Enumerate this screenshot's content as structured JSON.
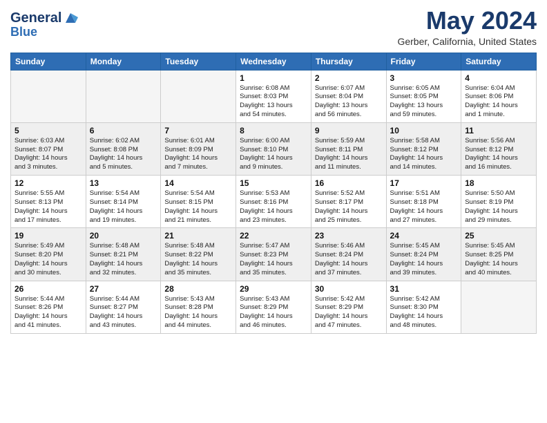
{
  "header": {
    "logo_line1": "General",
    "logo_line2": "Blue",
    "title": "May 2024",
    "subtitle": "Gerber, California, United States"
  },
  "weekdays": [
    "Sunday",
    "Monday",
    "Tuesday",
    "Wednesday",
    "Thursday",
    "Friday",
    "Saturday"
  ],
  "weeks": [
    [
      {
        "day": "",
        "info": ""
      },
      {
        "day": "",
        "info": ""
      },
      {
        "day": "",
        "info": ""
      },
      {
        "day": "1",
        "info": "Sunrise: 6:08 AM\nSunset: 8:03 PM\nDaylight: 13 hours\nand 54 minutes."
      },
      {
        "day": "2",
        "info": "Sunrise: 6:07 AM\nSunset: 8:04 PM\nDaylight: 13 hours\nand 56 minutes."
      },
      {
        "day": "3",
        "info": "Sunrise: 6:05 AM\nSunset: 8:05 PM\nDaylight: 13 hours\nand 59 minutes."
      },
      {
        "day": "4",
        "info": "Sunrise: 6:04 AM\nSunset: 8:06 PM\nDaylight: 14 hours\nand 1 minute."
      }
    ],
    [
      {
        "day": "5",
        "info": "Sunrise: 6:03 AM\nSunset: 8:07 PM\nDaylight: 14 hours\nand 3 minutes."
      },
      {
        "day": "6",
        "info": "Sunrise: 6:02 AM\nSunset: 8:08 PM\nDaylight: 14 hours\nand 5 minutes."
      },
      {
        "day": "7",
        "info": "Sunrise: 6:01 AM\nSunset: 8:09 PM\nDaylight: 14 hours\nand 7 minutes."
      },
      {
        "day": "8",
        "info": "Sunrise: 6:00 AM\nSunset: 8:10 PM\nDaylight: 14 hours\nand 9 minutes."
      },
      {
        "day": "9",
        "info": "Sunrise: 5:59 AM\nSunset: 8:11 PM\nDaylight: 14 hours\nand 11 minutes."
      },
      {
        "day": "10",
        "info": "Sunrise: 5:58 AM\nSunset: 8:12 PM\nDaylight: 14 hours\nand 14 minutes."
      },
      {
        "day": "11",
        "info": "Sunrise: 5:56 AM\nSunset: 8:12 PM\nDaylight: 14 hours\nand 16 minutes."
      }
    ],
    [
      {
        "day": "12",
        "info": "Sunrise: 5:55 AM\nSunset: 8:13 PM\nDaylight: 14 hours\nand 17 minutes."
      },
      {
        "day": "13",
        "info": "Sunrise: 5:54 AM\nSunset: 8:14 PM\nDaylight: 14 hours\nand 19 minutes."
      },
      {
        "day": "14",
        "info": "Sunrise: 5:54 AM\nSunset: 8:15 PM\nDaylight: 14 hours\nand 21 minutes."
      },
      {
        "day": "15",
        "info": "Sunrise: 5:53 AM\nSunset: 8:16 PM\nDaylight: 14 hours\nand 23 minutes."
      },
      {
        "day": "16",
        "info": "Sunrise: 5:52 AM\nSunset: 8:17 PM\nDaylight: 14 hours\nand 25 minutes."
      },
      {
        "day": "17",
        "info": "Sunrise: 5:51 AM\nSunset: 8:18 PM\nDaylight: 14 hours\nand 27 minutes."
      },
      {
        "day": "18",
        "info": "Sunrise: 5:50 AM\nSunset: 8:19 PM\nDaylight: 14 hours\nand 29 minutes."
      }
    ],
    [
      {
        "day": "19",
        "info": "Sunrise: 5:49 AM\nSunset: 8:20 PM\nDaylight: 14 hours\nand 30 minutes."
      },
      {
        "day": "20",
        "info": "Sunrise: 5:48 AM\nSunset: 8:21 PM\nDaylight: 14 hours\nand 32 minutes."
      },
      {
        "day": "21",
        "info": "Sunrise: 5:48 AM\nSunset: 8:22 PM\nDaylight: 14 hours\nand 35 minutes."
      },
      {
        "day": "22",
        "info": "Sunrise: 5:47 AM\nSunset: 8:23 PM\nDaylight: 14 hours\nand 35 minutes."
      },
      {
        "day": "23",
        "info": "Sunrise: 5:46 AM\nSunset: 8:24 PM\nDaylight: 14 hours\nand 37 minutes."
      },
      {
        "day": "24",
        "info": "Sunrise: 5:45 AM\nSunset: 8:24 PM\nDaylight: 14 hours\nand 39 minutes."
      },
      {
        "day": "25",
        "info": "Sunrise: 5:45 AM\nSunset: 8:25 PM\nDaylight: 14 hours\nand 40 minutes."
      }
    ],
    [
      {
        "day": "26",
        "info": "Sunrise: 5:44 AM\nSunset: 8:26 PM\nDaylight: 14 hours\nand 41 minutes."
      },
      {
        "day": "27",
        "info": "Sunrise: 5:44 AM\nSunset: 8:27 PM\nDaylight: 14 hours\nand 43 minutes."
      },
      {
        "day": "28",
        "info": "Sunrise: 5:43 AM\nSunset: 8:28 PM\nDaylight: 14 hours\nand 44 minutes."
      },
      {
        "day": "29",
        "info": "Sunrise: 5:43 AM\nSunset: 8:29 PM\nDaylight: 14 hours\nand 46 minutes."
      },
      {
        "day": "30",
        "info": "Sunrise: 5:42 AM\nSunset: 8:29 PM\nDaylight: 14 hours\nand 47 minutes."
      },
      {
        "day": "31",
        "info": "Sunrise: 5:42 AM\nSunset: 8:30 PM\nDaylight: 14 hours\nand 48 minutes."
      },
      {
        "day": "",
        "info": ""
      }
    ]
  ]
}
